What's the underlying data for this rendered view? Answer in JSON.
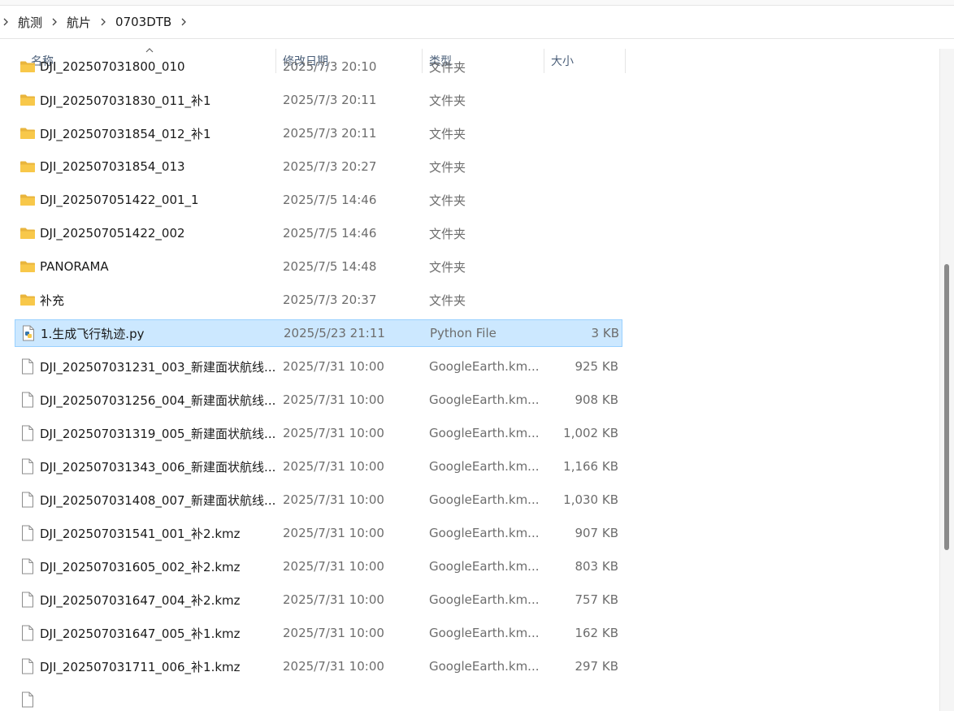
{
  "breadcrumb": {
    "items": [
      "航测",
      "航片",
      "0703DTB"
    ]
  },
  "columns": {
    "name": "名称",
    "date": "修改日期",
    "type": "类型",
    "size": "大小"
  },
  "rows": [
    {
      "icon": "folder-icon",
      "name": "DJI_202507031800_010",
      "date": "2025/7/3 20:10",
      "type": "文件夹",
      "size": ""
    },
    {
      "icon": "folder-icon",
      "name": "DJI_202507031830_011_补1",
      "date": "2025/7/3 20:11",
      "type": "文件夹",
      "size": ""
    },
    {
      "icon": "folder-icon",
      "name": "DJI_202507031854_012_补1",
      "date": "2025/7/3 20:11",
      "type": "文件夹",
      "size": ""
    },
    {
      "icon": "folder-icon",
      "name": "DJI_202507031854_013",
      "date": "2025/7/3 20:27",
      "type": "文件夹",
      "size": ""
    },
    {
      "icon": "folder-icon",
      "name": "DJI_202507051422_001_1",
      "date": "2025/7/5 14:46",
      "type": "文件夹",
      "size": ""
    },
    {
      "icon": "folder-icon",
      "name": "DJI_202507051422_002",
      "date": "2025/7/5 14:46",
      "type": "文件夹",
      "size": ""
    },
    {
      "icon": "folder-icon",
      "name": "PANORAMA",
      "date": "2025/7/5 14:48",
      "type": "文件夹",
      "size": ""
    },
    {
      "icon": "folder-icon",
      "name": "补充",
      "date": "2025/7/3 20:37",
      "type": "文件夹",
      "size": ""
    },
    {
      "icon": "python-file-icon",
      "name": "1.生成飞行轨迹.py",
      "date": "2025/5/23 21:11",
      "type": "Python File",
      "size": "3 KB",
      "selected": true
    },
    {
      "icon": "file-icon",
      "name": "DJI_202507031231_003_新建面状航线...",
      "date": "2025/7/31 10:00",
      "type": "GoogleEarth.km...",
      "size": "925 KB"
    },
    {
      "icon": "file-icon",
      "name": "DJI_202507031256_004_新建面状航线...",
      "date": "2025/7/31 10:00",
      "type": "GoogleEarth.km...",
      "size": "908 KB"
    },
    {
      "icon": "file-icon",
      "name": "DJI_202507031319_005_新建面状航线...",
      "date": "2025/7/31 10:00",
      "type": "GoogleEarth.km...",
      "size": "1,002 KB"
    },
    {
      "icon": "file-icon",
      "name": "DJI_202507031343_006_新建面状航线...",
      "date": "2025/7/31 10:00",
      "type": "GoogleEarth.km...",
      "size": "1,166 KB"
    },
    {
      "icon": "file-icon",
      "name": "DJI_202507031408_007_新建面状航线...",
      "date": "2025/7/31 10:00",
      "type": "GoogleEarth.km...",
      "size": "1,030 KB"
    },
    {
      "icon": "file-icon",
      "name": "DJI_202507031541_001_补2.kmz",
      "date": "2025/7/31 10:00",
      "type": "GoogleEarth.km...",
      "size": "907 KB"
    },
    {
      "icon": "file-icon",
      "name": "DJI_202507031605_002_补2.kmz",
      "date": "2025/7/31 10:00",
      "type": "GoogleEarth.km...",
      "size": "803 KB"
    },
    {
      "icon": "file-icon",
      "name": "DJI_202507031647_004_补2.kmz",
      "date": "2025/7/31 10:00",
      "type": "GoogleEarth.km...",
      "size": "757 KB"
    },
    {
      "icon": "file-icon",
      "name": "DJI_202507031647_005_补1.kmz",
      "date": "2025/7/31 10:00",
      "type": "GoogleEarth.km...",
      "size": "162 KB"
    },
    {
      "icon": "file-icon",
      "name": "DJI_202507031711_006_补1.kmz",
      "date": "2025/7/31 10:00",
      "type": "GoogleEarth.km...",
      "size": "297 KB"
    },
    {
      "icon": "file-icon",
      "name": "",
      "date": "",
      "type": "",
      "size": ""
    }
  ],
  "colors": {
    "selection_bg": "#cce8ff",
    "selection_border": "#99d1ff",
    "folder": "#f8c84a"
  }
}
